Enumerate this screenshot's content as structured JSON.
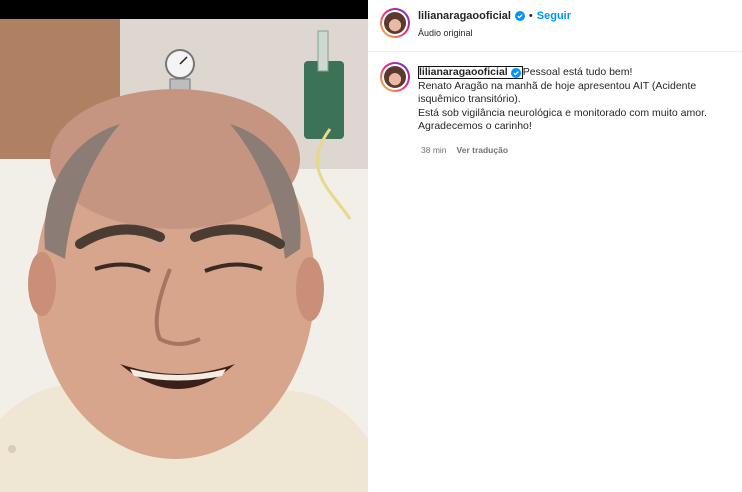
{
  "post": {
    "username": "lilianaragaooficial",
    "separator": "•",
    "follow_label": "Seguir",
    "audio_label": "Áudio original"
  },
  "caption": {
    "username": "lilianaragaooficial",
    "line1": "Pessoal está tudo bem!",
    "line2": "Renato Aragão na manhã de hoje apresentou AIT (Acidente isquêmico transitório).",
    "line3": "Está sob vigilância neurológica e monitorado com muito amor.",
    "line4": "Agradecemos o carinho!",
    "time": "38 min",
    "translate_label": "Ver tradução"
  },
  "colors": {
    "follow": "#0095f6",
    "verified": "#0095f6",
    "muted": "#737373"
  }
}
